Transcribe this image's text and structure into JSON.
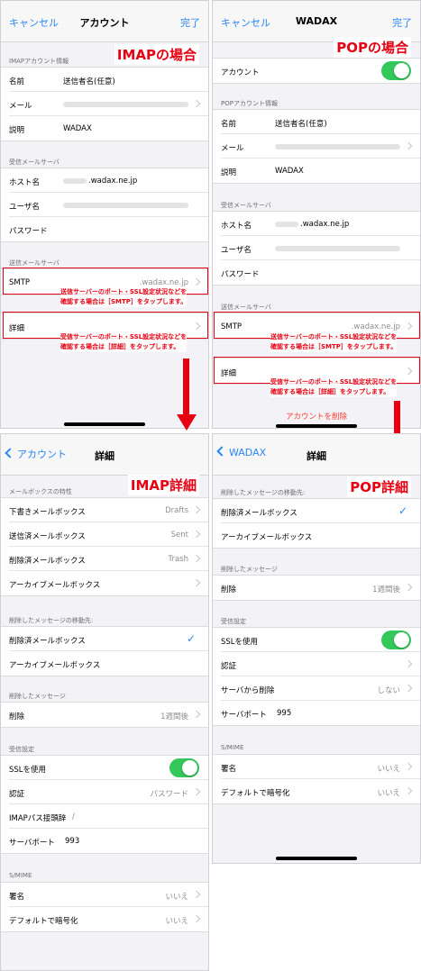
{
  "imap_account": {
    "nav": {
      "cancel": "キャンセル",
      "title": "アカウント",
      "done": "完了"
    },
    "badge": "IMAPの場合",
    "section_account": "IMAPアカウント情報",
    "rows_account": [
      {
        "key": "名前",
        "value": "送信者名(任意)"
      },
      {
        "key": "メール",
        "value": ""
      },
      {
        "key": "説明",
        "value": "WADAX"
      }
    ],
    "section_incoming": "受信メールサーバ",
    "rows_incoming": [
      {
        "key": "ホスト名",
        "value": ".wadax.ne.jp"
      },
      {
        "key": "ユーザ名",
        "value": ""
      },
      {
        "key": "パスワード",
        "value": ""
      }
    ],
    "section_outgoing": "送信メールサーバ",
    "smtp": {
      "key": "SMTP",
      "value": ".wadax.ne.jp"
    },
    "note_smtp": [
      "送信サーバーのポート・SSL設定状況などを",
      "確認する場合は［SMTP］をタップします。"
    ],
    "detail": {
      "key": "詳細"
    },
    "note_detail": [
      "受信サーバーのポート・SSL設定状況などを",
      "確認する場合は［詳細］をタップします。"
    ]
  },
  "pop_account": {
    "nav": {
      "cancel": "キャンセル",
      "title": "WADAX",
      "done": "完了"
    },
    "badge": "POPの場合",
    "account_label": "アカウント",
    "section_account": "POPアカウント情報",
    "rows_account": [
      {
        "key": "名前",
        "value": "送信者名(任意)"
      },
      {
        "key": "メール",
        "value": ""
      },
      {
        "key": "説明",
        "value": "WADAX"
      }
    ],
    "section_incoming": "受信メールサーバ",
    "rows_incoming": [
      {
        "key": "ホスト名",
        "value": ".wadax.ne.jp"
      },
      {
        "key": "ユーザ名",
        "value": ""
      },
      {
        "key": "パスワード",
        "value": ""
      }
    ],
    "section_outgoing": "送信メールサーバ",
    "smtp": {
      "key": "SMTP",
      "value": ".wadax.ne.jp"
    },
    "note_smtp": [
      "送信サーバーのポート・SSL設定状況などを",
      "確認する場合は［SMTP］をタップします。"
    ],
    "detail": {
      "key": "詳細"
    },
    "note_detail": [
      "受信サーバーのポート・SSL設定状況などを",
      "確認する場合は［詳細］をタップします。"
    ],
    "delete_account": "アカウントを削除"
  },
  "imap_detail": {
    "nav": {
      "back": "アカウント",
      "title": "詳細"
    },
    "badge": "IMAP詳細",
    "section_mailbox": "メールボックスの特性",
    "rows_mailbox": [
      {
        "key": "下書きメールボックス",
        "value": "Drafts"
      },
      {
        "key": "送信済メールボックス",
        "value": "Sent"
      },
      {
        "key": "削除済メールボックス",
        "value": "Trash"
      },
      {
        "key": "アーカイブメールボックス",
        "value": ""
      }
    ],
    "section_move": "削除したメッセージの移動先:",
    "rows_move": [
      {
        "key": "削除済メールボックス",
        "value": "✓"
      },
      {
        "key": "アーカイブメールボックス",
        "value": ""
      }
    ],
    "section_deleted": "削除したメッセージ",
    "rows_deleted": [
      {
        "key": "削除",
        "value": "1週間後"
      }
    ],
    "section_incoming": "受信設定",
    "rows_incoming": [
      {
        "key": "SSLを使用",
        "value": ""
      },
      {
        "key": "認証",
        "value": "パスワード"
      },
      {
        "key": "IMAPパス接頭辞",
        "value": "/"
      },
      {
        "key": "サーバポート",
        "value": "993"
      }
    ],
    "section_smime": "S/MIME",
    "rows_smime": [
      {
        "key": "署名",
        "value": "いいえ"
      },
      {
        "key": "デフォルトで暗号化",
        "value": "いいえ"
      }
    ]
  },
  "pop_detail": {
    "nav": {
      "back": "WADAX",
      "title": "詳細"
    },
    "badge": "POP詳細",
    "section_move": "削除したメッセージの移動先:",
    "rows_move": [
      {
        "key": "削除済メールボックス",
        "value": "✓"
      },
      {
        "key": "アーカイブメールボックス",
        "value": ""
      }
    ],
    "section_deleted": "削除したメッセージ",
    "rows_deleted": [
      {
        "key": "削除",
        "value": "1週間後"
      }
    ],
    "section_incoming": "受信設定",
    "rows_incoming": [
      {
        "key": "SSLを使用",
        "value": ""
      },
      {
        "key": "認証",
        "value": ""
      },
      {
        "key": "サーバから削除",
        "value": "しない"
      },
      {
        "key": "サーバポート",
        "value": "995"
      }
    ],
    "section_smime": "S/MIME",
    "rows_smime": [
      {
        "key": "署名",
        "value": "いいえ"
      },
      {
        "key": "デフォルトで暗号化",
        "value": "いいえ"
      }
    ]
  },
  "colors": {
    "accent": "#2a86f3",
    "annotation": "#e60012",
    "toggle_on": "#34c759",
    "destructive": "#ff3b30"
  }
}
